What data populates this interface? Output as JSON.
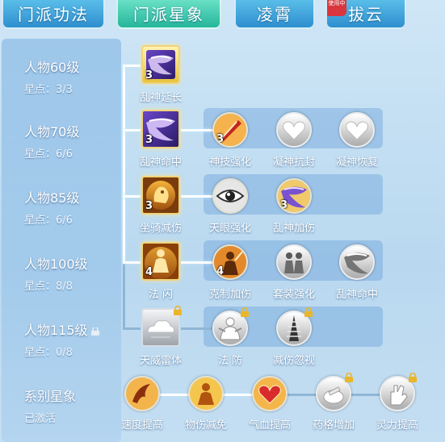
{
  "tabs": [
    {
      "label": "门派功法",
      "active": false
    },
    {
      "label": "门派星象",
      "active": true
    },
    {
      "label": "凌霄",
      "active": false
    },
    {
      "label": "拔云",
      "active": false,
      "ribbon": "使用中"
    }
  ],
  "rows": [
    {
      "title": "人物60级",
      "sub": "星点：3/3",
      "locked": false
    },
    {
      "title": "人物70级",
      "sub": "星点：6/6",
      "locked": false
    },
    {
      "title": "人物85级",
      "sub": "星点：6/6",
      "locked": false
    },
    {
      "title": "人物100级",
      "sub": "星点：8/8",
      "locked": false
    },
    {
      "title": "人物115级",
      "sub": "星点：0/8",
      "locked": true
    }
  ],
  "main_nodes": [
    {
      "label": "乱神延长",
      "level": "3",
      "icon": "scarf-purple-icon"
    },
    {
      "label": "乱神命中",
      "level": "3",
      "icon": "scarf-purple-icon"
    },
    {
      "label": "坐骑减伤",
      "level": "3",
      "icon": "golden-beast-icon"
    },
    {
      "label": "法 闪",
      "level": "4",
      "icon": "golden-figure-icon"
    },
    {
      "label": "天威雷体",
      "level": "",
      "icon": "cloud-icon",
      "locked": true
    }
  ],
  "sub_nodes": {
    "row70": [
      {
        "label": "神技强化",
        "level": "3",
        "icon": "blade-icon"
      },
      {
        "label": "凝神抗封",
        "level": "",
        "icon": "heart-icon"
      },
      {
        "label": "凝神恢复",
        "level": "",
        "icon": "heart-icon"
      }
    ],
    "row85": [
      {
        "label": "天眼强化",
        "level": "",
        "icon": "eye-icon"
      },
      {
        "label": "乱神加伤",
        "level": "3",
        "icon": "scarf-purple-icon"
      }
    ],
    "row100": [
      {
        "label": "克制加伤",
        "level": "4",
        "icon": "warrior-icon"
      },
      {
        "label": "套装强化",
        "level": "",
        "icon": "warriors-icon"
      },
      {
        "label": "乱神命中",
        "level": "",
        "icon": "scarf-icon"
      }
    ],
    "row115": [
      {
        "label": "法 防",
        "level": "",
        "icon": "monk-icon",
        "locked": true
      },
      {
        "label": "减伤忽视",
        "level": "",
        "icon": "tower-icon",
        "locked": true
      }
    ]
  },
  "constellation": {
    "title": "系别星象",
    "status": "已激活",
    "nodes": [
      {
        "label": "速度提高",
        "icon": "speed-icon",
        "locked": false
      },
      {
        "label": "物伤减免",
        "icon": "shield-figure-icon",
        "locked": false
      },
      {
        "label": "气血提高",
        "icon": "heart-red-icon",
        "locked": false
      },
      {
        "label": "药格增加",
        "icon": "medicine-icon",
        "locked": true
      },
      {
        "label": "灵力提高",
        "icon": "spirit-hand-icon",
        "locked": true
      }
    ]
  },
  "colors": {
    "active_line": "#ffffff",
    "gold_border": "#f0d37a",
    "tab_active": "#25b59a",
    "tab_inactive": "#2e8fcf"
  }
}
